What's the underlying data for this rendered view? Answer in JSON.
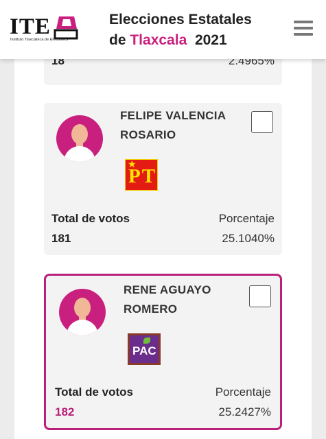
{
  "header": {
    "logo_text": "ITE",
    "logo_subtitle": "Instituto Tlaxcalteca de Elecciones",
    "title_line1": "Elecciones Estatales",
    "title_de": "de",
    "title_state": "Tlaxcala",
    "title_year": "2021",
    "menu_icon": "hamburger-menu-icon"
  },
  "colors": {
    "accent": "#c9207f",
    "card_selected_border": "#b8207a"
  },
  "previous_card": {
    "votes": "18",
    "percentage": "2.4965%"
  },
  "candidates": [
    {
      "name_line1": "FELIPE VALENCIA",
      "name_line2": "ROSARIO",
      "party_logo": "PT",
      "total_label": "Total de votos",
      "votes": "181",
      "percentage_label": "Porcentaje",
      "percentage": "25.1040%",
      "selected": false
    },
    {
      "name_line1": "RENE AGUAYO",
      "name_line2": "ROMERO",
      "party_logo": "PAC",
      "total_label": "Total de votos",
      "votes": "182",
      "percentage_label": "Porcentaje",
      "percentage": "25.2427%",
      "selected": true
    }
  ]
}
